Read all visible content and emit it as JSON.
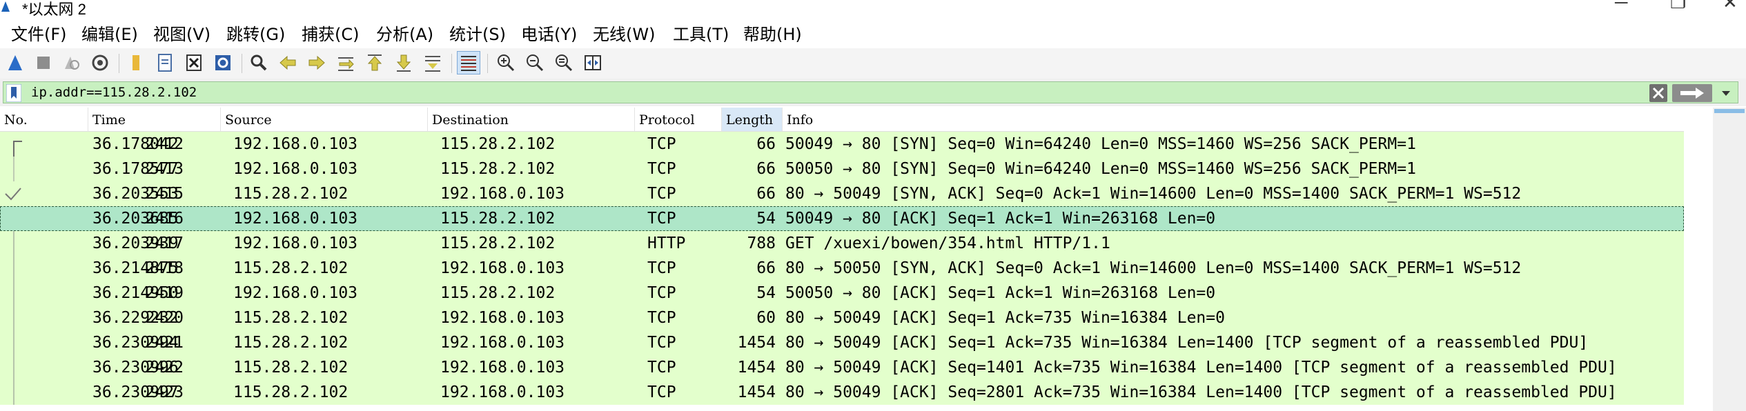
{
  "window": {
    "title": "*以太网 2",
    "minimize_glyph": "─",
    "restore_glyph": "❐",
    "close_glyph": "✕"
  },
  "menu": [
    {
      "label": "文件(F)"
    },
    {
      "label": "编辑(E)"
    },
    {
      "label": "视图(V)"
    },
    {
      "label": "跳转(G)"
    },
    {
      "label": "捕获(C)"
    },
    {
      "label": "分析(A)"
    },
    {
      "label": "统计(S)"
    },
    {
      "label": "电话(Y)"
    },
    {
      "label": "无线(W)"
    },
    {
      "label": "工具(T)"
    },
    {
      "label": "帮助(H)"
    }
  ],
  "toolbar": {
    "icons": [
      "shark-fin-start-icon",
      "stop-icon",
      "restart-icon",
      "capture-options-icon",
      "open-folder-icon",
      "file-icon",
      "close-file-icon",
      "reload-icon",
      "find-icon",
      "back-arrow-icon",
      "forward-arrow-icon",
      "goto-packet-icon",
      "first-packet-icon",
      "last-packet-icon",
      "autoscroll-icon",
      "colorize-icon",
      "zoom-in-icon",
      "zoom-out-icon",
      "zoom-normal-icon",
      "resize-columns-icon"
    ]
  },
  "filter": {
    "value": "ip.addr==115.28.2.102"
  },
  "columns": [
    "No.",
    "Time",
    "Source",
    "Destination",
    "Protocol",
    "Length",
    "Info"
  ],
  "packets": [
    {
      "no": "2412",
      "time": "36.178042",
      "src": "192.168.0.103",
      "dst": "115.28.2.102",
      "proto": "TCP",
      "len": "66",
      "info": "50049 → 80 [SYN] Seq=0 Win=64240 Len=0 MSS=1460 WS=256 SACK_PERM=1"
    },
    {
      "no": "2413",
      "time": "36.178577",
      "src": "192.168.0.103",
      "dst": "115.28.2.102",
      "proto": "TCP",
      "len": "66",
      "info": "50050 → 80 [SYN] Seq=0 Win=64240 Len=0 MSS=1460 WS=256 SACK_PERM=1"
    },
    {
      "no": "2415",
      "time": "36.203553",
      "src": "115.28.2.102",
      "dst": "192.168.0.103",
      "proto": "TCP",
      "len": "66",
      "info": "80 → 50049 [SYN, ACK] Seq=0 Ack=1 Win=14600 Len=0 MSS=1400 SACK_PERM=1 WS=512"
    },
    {
      "no": "2416",
      "time": "36.203685",
      "src": "192.168.0.103",
      "dst": "115.28.2.102",
      "proto": "TCP",
      "len": "54",
      "info": "50049 → 80 [ACK] Seq=1 Ack=1 Win=263168 Len=0"
    },
    {
      "no": "2417",
      "time": "36.203939",
      "src": "192.168.0.103",
      "dst": "115.28.2.102",
      "proto": "HTTP",
      "len": "788",
      "info": "GET /xuexi/bowen/354.html HTTP/1.1"
    },
    {
      "no": "2418",
      "time": "36.214875",
      "src": "115.28.2.102",
      "dst": "192.168.0.103",
      "proto": "TCP",
      "len": "66",
      "info": "80 → 50050 [SYN, ACK] Seq=0 Ack=1 Win=14600 Len=0 MSS=1400 SACK_PERM=1 WS=512"
    },
    {
      "no": "2419",
      "time": "36.214950",
      "src": "192.168.0.103",
      "dst": "115.28.2.102",
      "proto": "TCP",
      "len": "54",
      "info": "50050 → 80 [ACK] Seq=1 Ack=1 Win=263168 Len=0"
    },
    {
      "no": "2420",
      "time": "36.229232",
      "src": "115.28.2.102",
      "dst": "192.168.0.103",
      "proto": "TCP",
      "len": "60",
      "info": "80 → 50049 [ACK] Seq=1 Ack=735 Win=16384 Len=0"
    },
    {
      "no": "2421",
      "time": "36.230994",
      "src": "115.28.2.102",
      "dst": "192.168.0.103",
      "proto": "TCP",
      "len": "1454",
      "info": "80 → 50049 [ACK] Seq=1 Ack=735 Win=16384 Len=1400 [TCP segment of a reassembled PDU]"
    },
    {
      "no": "2422",
      "time": "36.230996",
      "src": "115.28.2.102",
      "dst": "192.168.0.103",
      "proto": "TCP",
      "len": "1454",
      "info": "80 → 50049 [ACK] Seq=1401 Ack=735 Win=16384 Len=1400 [TCP segment of a reassembled PDU]"
    },
    {
      "no": "2423",
      "time": "36.230997",
      "src": "115.28.2.102",
      "dst": "192.168.0.103",
      "proto": "TCP",
      "len": "1454",
      "info": "80 → 50049 [ACK] Seq=2801 Ack=735 Win=16384 Len=1400 [TCP segment of a reassembled PDU]"
    }
  ],
  "selected_index": 3,
  "colors": {
    "row_tcp": "#e3ffcc",
    "row_selected": "#aee6c8",
    "filter_valid": "#c8f0c0",
    "sorted_header": "#d9e8f7"
  }
}
